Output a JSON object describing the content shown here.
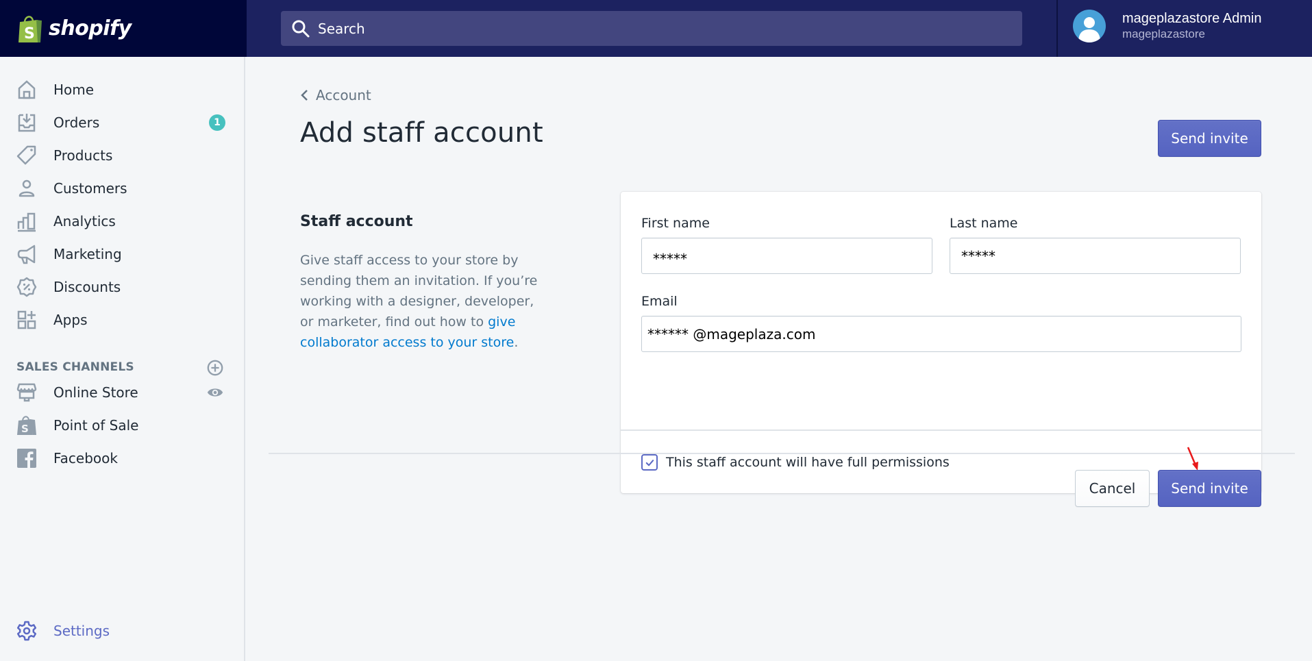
{
  "topbar": {
    "brand": "shopify",
    "search_placeholder": "Search",
    "user": {
      "name": "mageplazastore Admin",
      "store": "mageplazastore"
    }
  },
  "sidebar": {
    "items": [
      {
        "label": "Home",
        "icon": "home-icon"
      },
      {
        "label": "Orders",
        "icon": "orders-icon",
        "badge": "1"
      },
      {
        "label": "Products",
        "icon": "tag-icon"
      },
      {
        "label": "Customers",
        "icon": "person-icon"
      },
      {
        "label": "Analytics",
        "icon": "bar-chart-icon"
      },
      {
        "label": "Marketing",
        "icon": "megaphone-icon"
      },
      {
        "label": "Discounts",
        "icon": "discount-icon"
      },
      {
        "label": "Apps",
        "icon": "apps-icon"
      }
    ],
    "sales_channels_title": "SALES CHANNELS",
    "channels": [
      {
        "label": "Online Store",
        "icon": "store-icon"
      },
      {
        "label": "Point of Sale",
        "icon": "pos-bag-icon"
      },
      {
        "label": "Facebook",
        "icon": "facebook-icon"
      }
    ],
    "settings_label": "Settings"
  },
  "main": {
    "breadcrumb": "Account",
    "title": "Add staff account",
    "send_invite_label": "Send invite",
    "cancel_label": "Cancel",
    "section": {
      "heading": "Staff account",
      "desc_text": "Give staff access to your store by sending them an invitation. If you’re working with a designer, developer, or marketer, find out how to ",
      "desc_link": "give collaborator access to your store",
      "desc_end": "."
    },
    "form": {
      "first_name_label": "First name",
      "first_name_value": "*****",
      "last_name_label": "Last name",
      "last_name_value": "*****",
      "email_label": "Email",
      "email_value": "****** @mageplaza.com",
      "full_permissions_label": "This staff account will have full permissions",
      "full_permissions_checked": true
    }
  },
  "colors": {
    "topbar": "#1c2260",
    "logo_bg": "#000639",
    "primary": "#5c6ac4",
    "badge": "#47c1bf",
    "link": "#007ace",
    "annotation_arrow": "#e8191b"
  }
}
